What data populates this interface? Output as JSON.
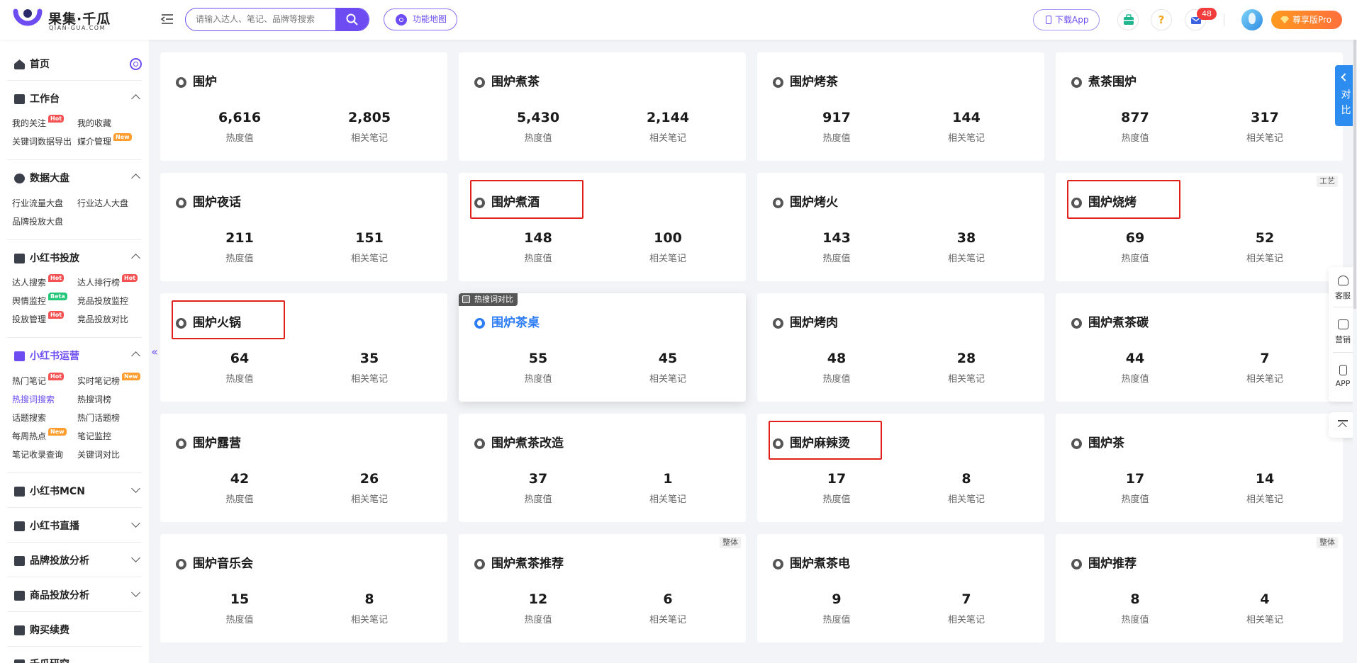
{
  "header": {
    "logo_cn": "果集·千瓜",
    "logo_en": "QIAN-GUA.COM",
    "search_placeholder": "请输入达人、笔记、品牌等搜索",
    "function_map": "功能地图",
    "download_app": "下载App",
    "help": "?",
    "message_count": "48",
    "pro_label": "尊享版Pro",
    "colors": {
      "brand": "#6d4df2",
      "pro": "#ff8a2a",
      "badge": "#f23c3c"
    }
  },
  "sidebar": {
    "home": "首页",
    "sections": [
      {
        "title": "工作台",
        "expanded": true,
        "items": [
          {
            "label": "我的关注",
            "tag": "Hot"
          },
          {
            "label": "我的收藏",
            "tag": ""
          },
          {
            "label": "关键词数据导出",
            "tag": ""
          },
          {
            "label": "媒介管理",
            "tag": "New"
          }
        ]
      },
      {
        "title": "数据大盘",
        "expanded": true,
        "items": [
          {
            "label": "行业流量大盘",
            "tag": ""
          },
          {
            "label": "行业达人大盘",
            "tag": ""
          },
          {
            "label": "品牌投放大盘",
            "tag": ""
          }
        ]
      },
      {
        "title": "小红书投放",
        "expanded": true,
        "items": [
          {
            "label": "达人搜索",
            "tag": "Hot"
          },
          {
            "label": "达人排行榜",
            "tag": "Hot"
          },
          {
            "label": "舆情监控",
            "tag": "Beta"
          },
          {
            "label": "竞品投放监控",
            "tag": ""
          },
          {
            "label": "投放管理",
            "tag": "Hot"
          },
          {
            "label": "竞品投放对比",
            "tag": ""
          }
        ]
      },
      {
        "title": "小红书运营",
        "expanded": true,
        "active": true,
        "items": [
          {
            "label": "热门笔记",
            "tag": "Hot"
          },
          {
            "label": "实时笔记榜",
            "tag": "New"
          },
          {
            "label": "热搜词搜索",
            "tag": "",
            "active": true
          },
          {
            "label": "热搜词榜",
            "tag": ""
          },
          {
            "label": "话题搜索",
            "tag": ""
          },
          {
            "label": "热门话题榜",
            "tag": ""
          },
          {
            "label": "每周热点",
            "tag": "New"
          },
          {
            "label": "笔记监控",
            "tag": ""
          },
          {
            "label": "笔记收录查询",
            "tag": ""
          },
          {
            "label": "关键词对比",
            "tag": ""
          }
        ]
      },
      {
        "title": "小红书MCN",
        "expanded": false,
        "items": []
      },
      {
        "title": "小红书直播",
        "expanded": false,
        "items": []
      },
      {
        "title": "品牌投放分析",
        "expanded": false,
        "items": []
      },
      {
        "title": "商品投放分析",
        "expanded": false,
        "items": []
      },
      {
        "title": "购买续费",
        "expanded": false,
        "items": []
      },
      {
        "title": "千瓜研究",
        "expanded": false,
        "items": []
      }
    ]
  },
  "labels": {
    "heat": "热度值",
    "notes": "相关笔记",
    "compare_hot": "热搜词对比"
  },
  "cards": [
    {
      "title": "围炉",
      "heat": "6,616",
      "notes": "2,805",
      "corner": "",
      "highlighted": false,
      "hover": false
    },
    {
      "title": "围炉煮茶",
      "heat": "5,430",
      "notes": "2,144",
      "corner": "",
      "highlighted": false,
      "hover": false
    },
    {
      "title": "围炉烤茶",
      "heat": "917",
      "notes": "144",
      "corner": "",
      "highlighted": false,
      "hover": false
    },
    {
      "title": "煮茶围炉",
      "heat": "877",
      "notes": "317",
      "corner": "",
      "highlighted": false,
      "hover": false
    },
    {
      "title": "围炉夜话",
      "heat": "211",
      "notes": "151",
      "corner": "",
      "highlighted": false,
      "hover": false
    },
    {
      "title": "围炉煮酒",
      "heat": "148",
      "notes": "100",
      "corner": "",
      "highlighted": true,
      "hover": false
    },
    {
      "title": "围炉烤火",
      "heat": "143",
      "notes": "38",
      "corner": "",
      "highlighted": false,
      "hover": false
    },
    {
      "title": "围炉烧烤",
      "heat": "69",
      "notes": "52",
      "corner": "工艺",
      "highlighted": true,
      "hover": false
    },
    {
      "title": "围炉火锅",
      "heat": "64",
      "notes": "35",
      "corner": "",
      "highlighted": true,
      "hover": false
    },
    {
      "title": "围炉茶桌",
      "heat": "55",
      "notes": "45",
      "corner": "",
      "highlighted": false,
      "hover": true
    },
    {
      "title": "围炉烤肉",
      "heat": "48",
      "notes": "28",
      "corner": "",
      "highlighted": false,
      "hover": false
    },
    {
      "title": "围炉煮茶碳",
      "heat": "44",
      "notes": "7",
      "corner": "",
      "highlighted": false,
      "hover": false
    },
    {
      "title": "围炉露营",
      "heat": "42",
      "notes": "26",
      "corner": "",
      "highlighted": false,
      "hover": false
    },
    {
      "title": "围炉煮茶改造",
      "heat": "37",
      "notes": "1",
      "corner": "",
      "highlighted": false,
      "hover": false
    },
    {
      "title": "围炉麻辣烫",
      "heat": "17",
      "notes": "8",
      "corner": "",
      "highlighted": true,
      "hover": false
    },
    {
      "title": "围炉茶",
      "heat": "17",
      "notes": "14",
      "corner": "",
      "highlighted": false,
      "hover": false
    },
    {
      "title": "围炉音乐会",
      "heat": "15",
      "notes": "8",
      "corner": "",
      "highlighted": false,
      "hover": false
    },
    {
      "title": "围炉煮茶推荐",
      "heat": "12",
      "notes": "6",
      "corner": "整体",
      "highlighted": false,
      "hover": false
    },
    {
      "title": "围炉煮茶电",
      "heat": "9",
      "notes": "7",
      "corner": "",
      "highlighted": false,
      "hover": false
    },
    {
      "title": "围炉推荐",
      "heat": "8",
      "notes": "4",
      "corner": "整体",
      "highlighted": false,
      "hover": false
    }
  ],
  "right_tools": {
    "compare_1": "对",
    "compare_2": "比",
    "service": "客服",
    "marketing": "营销",
    "app": "APP"
  }
}
